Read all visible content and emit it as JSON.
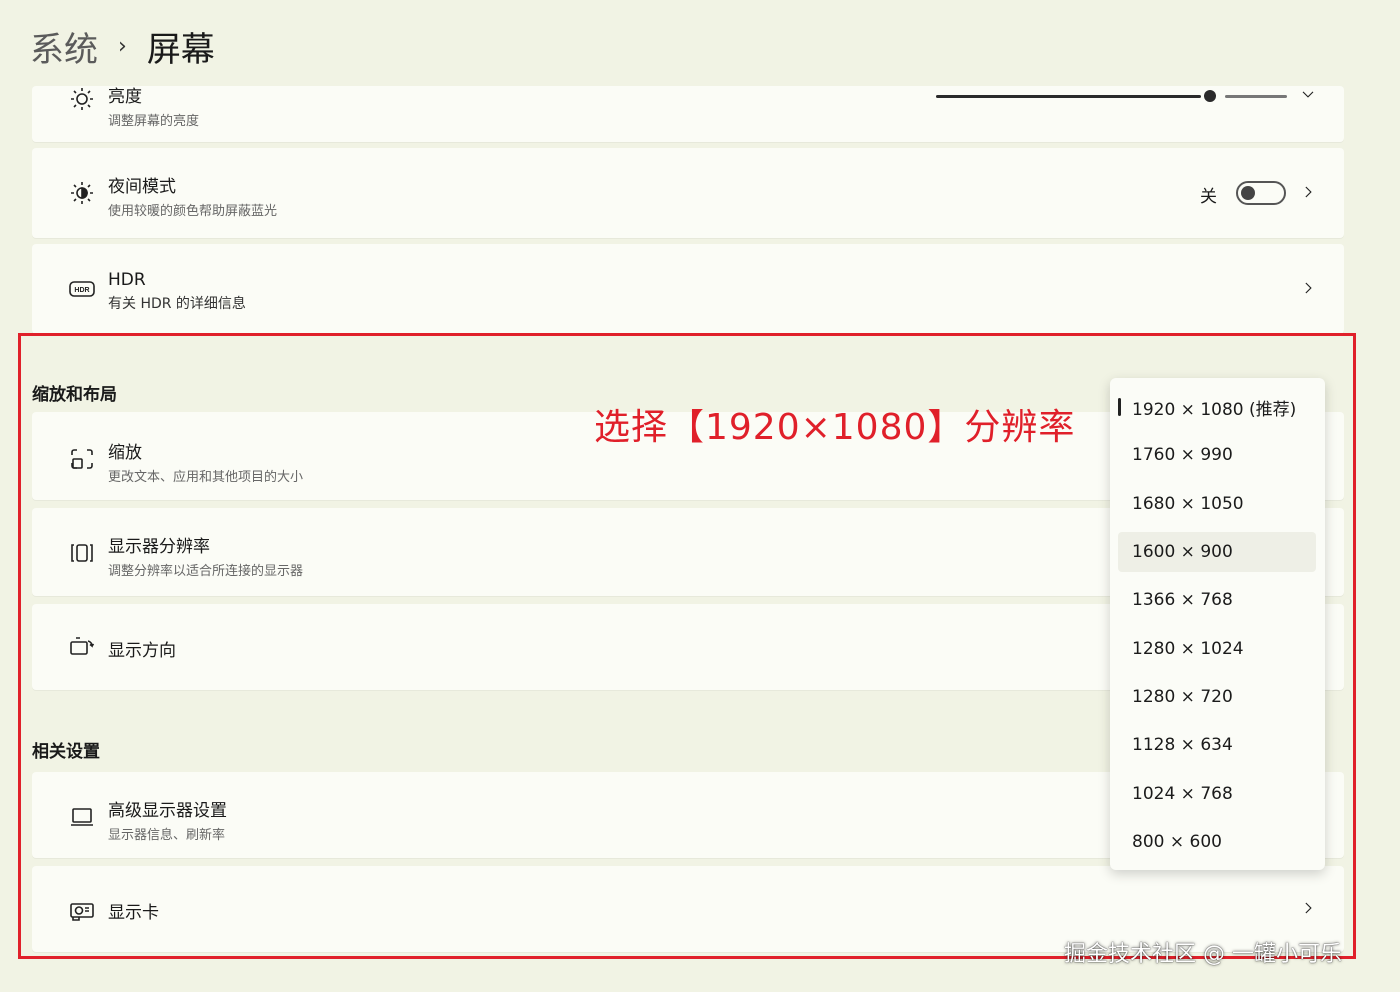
{
  "breadcrumb": {
    "parent": "系统",
    "separator": "›",
    "current": "屏幕"
  },
  "cards": {
    "brightness": {
      "title": "亮度",
      "subtitle": "调整屏幕的亮度",
      "icon": "sun-icon",
      "level": 0.85
    },
    "night": {
      "title": "夜间模式",
      "subtitle": "使用较暖的颜色帮助屏蔽蓝光",
      "toggle_label": "关",
      "icon": "night-sun-icon"
    },
    "hdr": {
      "title": "HDR",
      "subtitle": "有关 HDR 的详细信息",
      "icon": "hdr-icon"
    },
    "scale": {
      "title": "缩放",
      "subtitle": "更改文本、应用和其他项目的大小",
      "icon": "scale-icon"
    },
    "resolution": {
      "title": "显示器分辨率",
      "subtitle": "调整分辨率以适合所连接的显示器",
      "icon": "resolution-icon"
    },
    "orientation": {
      "title": "显示方向",
      "icon": "orientation-icon"
    },
    "advanced": {
      "title": "高级显示器设置",
      "subtitle": "显示器信息、刷新率",
      "icon": "monitor-icon"
    },
    "gpu": {
      "title": "显示卡",
      "icon": "gpu-icon"
    }
  },
  "sections": {
    "scale_layout": "缩放和布局",
    "related": "相关设置"
  },
  "resolution_options": [
    "1920 × 1080 (推荐)",
    "1760 × 990",
    "1680 × 1050",
    "1600 × 900",
    "1366 × 768",
    "1280 × 1024",
    "1280 × 720",
    "1128 × 634",
    "1024 × 768",
    "800 × 600"
  ],
  "selected_option": "1920 × 1080 (推荐)",
  "annotation": "选择【1920×1080】分辨率",
  "watermark": "掘金技术社区 @ 一罐小可乐",
  "colors": {
    "background": "#f1f3e4",
    "card": "#fbfcf6",
    "annotation_red": "#e0202a"
  }
}
